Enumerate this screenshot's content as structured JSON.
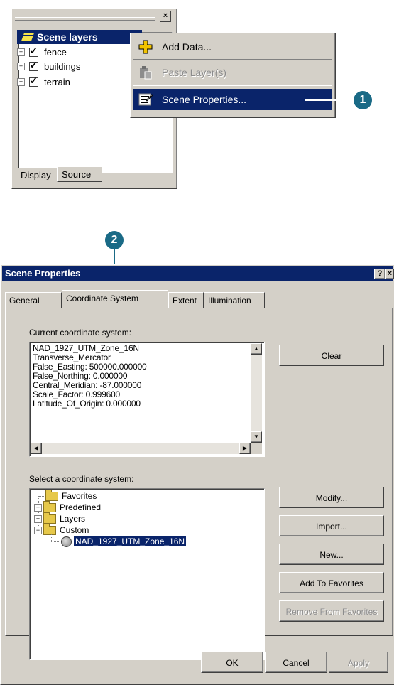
{
  "toc": {
    "root_label": "Scene layers",
    "layers": [
      "fence",
      "buildings",
      "terrain"
    ],
    "tabs": [
      "Display",
      "Source"
    ]
  },
  "context_menu": {
    "items": [
      {
        "label": "Add Data...",
        "icon": "add-data-icon",
        "state": "normal"
      },
      {
        "label": "Paste Layer(s)",
        "icon": "paste-icon",
        "state": "disabled"
      },
      {
        "label": "Scene Properties...",
        "icon": "properties-icon",
        "state": "selected"
      }
    ]
  },
  "callouts": [
    "1",
    "2"
  ],
  "dialog": {
    "title": "Scene Properties",
    "help_glyph": "?",
    "close_glyph": "×",
    "tabs": [
      "General",
      "Coordinate System",
      "Extent",
      "Illumination"
    ],
    "current_label": "Current coordinate system:",
    "current_lines": [
      "NAD_1927_UTM_Zone_16N",
      "Transverse_Mercator",
      "False_Easting: 500000.000000",
      "False_Northing: 0.000000",
      "Central_Meridian: -87.000000",
      "Scale_Factor: 0.999600",
      "Latitude_Of_Origin: 0.000000"
    ],
    "clear_button": "Clear",
    "select_label": "Select a coordinate system:",
    "tree": {
      "favorites": "Favorites",
      "predefined": "Predefined",
      "layers": "Layers",
      "custom": "Custom",
      "custom_child": "NAD_1927_UTM_Zone_16N"
    },
    "side_buttons": [
      "Modify...",
      "Import...",
      "New...",
      "Add To Favorites",
      "Remove From Favorites"
    ],
    "ok_button": "OK",
    "cancel_button": "Cancel",
    "apply_button": "Apply"
  },
  "colors": {
    "selection": "#0a246a",
    "face": "#d4d0c8",
    "callout": "#1a6a86"
  }
}
